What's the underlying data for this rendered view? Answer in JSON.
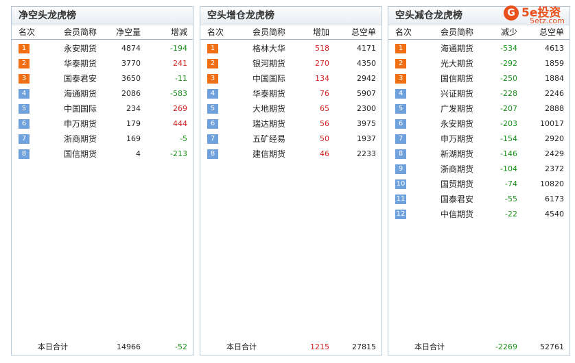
{
  "logo": {
    "mark": "G",
    "text": "5e投资",
    "sub": "5etz.com"
  },
  "panels": [
    {
      "title": "净空头龙虎榜",
      "headers": [
        "名次",
        "会员简称",
        "净空量",
        "增减"
      ],
      "rows": [
        {
          "rank": "1",
          "name": "永安期货",
          "v1": "4874",
          "v2": "-194",
          "c2": "green"
        },
        {
          "rank": "2",
          "name": "华泰期货",
          "v1": "3770",
          "v2": "241",
          "c2": "red"
        },
        {
          "rank": "3",
          "name": "国泰君安",
          "v1": "3650",
          "v2": "-11",
          "c2": "green"
        },
        {
          "rank": "4",
          "name": "海通期货",
          "v1": "2086",
          "v2": "-583",
          "c2": "green"
        },
        {
          "rank": "5",
          "name": "中国国际",
          "v1": "234",
          "v2": "269",
          "c2": "red"
        },
        {
          "rank": "6",
          "name": "申万期货",
          "v1": "179",
          "v2": "444",
          "c2": "red"
        },
        {
          "rank": "7",
          "name": "浙商期货",
          "v1": "169",
          "v2": "-5",
          "c2": "green"
        },
        {
          "rank": "8",
          "name": "国信期货",
          "v1": "4",
          "v2": "-213",
          "c2": "green"
        }
      ],
      "footer": {
        "label": "本日合计",
        "v1": "14966",
        "v2": "-52"
      }
    },
    {
      "title": "空头增仓龙虎榜",
      "headers": [
        "名次",
        "会员简称",
        "增加",
        "总空单"
      ],
      "rows": [
        {
          "rank": "1",
          "name": "格林大华",
          "v1": "518",
          "v2": "4171"
        },
        {
          "rank": "2",
          "name": "银河期货",
          "v1": "270",
          "v2": "4350"
        },
        {
          "rank": "3",
          "name": "中国国际",
          "v1": "134",
          "v2": "2942"
        },
        {
          "rank": "4",
          "name": "华泰期货",
          "v1": "76",
          "v2": "5907"
        },
        {
          "rank": "5",
          "name": "大地期货",
          "v1": "65",
          "v2": "2300"
        },
        {
          "rank": "6",
          "name": "瑞达期货",
          "v1": "56",
          "v2": "3975"
        },
        {
          "rank": "7",
          "name": "五矿经易",
          "v1": "50",
          "v2": "1937"
        },
        {
          "rank": "8",
          "name": "建信期货",
          "v1": "46",
          "v2": "2233"
        }
      ],
      "footer": {
        "label": "本日合计",
        "v1": "1215",
        "v2": "27815"
      }
    },
    {
      "title": "空头减仓龙虎榜",
      "headers": [
        "名次",
        "会员简称",
        "减少",
        "总空单"
      ],
      "rows": [
        {
          "rank": "1",
          "name": "海通期货",
          "v1": "-534",
          "v2": "4613"
        },
        {
          "rank": "2",
          "name": "光大期货",
          "v1": "-292",
          "v2": "1859"
        },
        {
          "rank": "3",
          "name": "国信期货",
          "v1": "-250",
          "v2": "1884"
        },
        {
          "rank": "4",
          "name": "兴证期货",
          "v1": "-228",
          "v2": "2246"
        },
        {
          "rank": "5",
          "name": "广发期货",
          "v1": "-207",
          "v2": "2888"
        },
        {
          "rank": "6",
          "name": "永安期货",
          "v1": "-203",
          "v2": "10017"
        },
        {
          "rank": "7",
          "name": "申万期货",
          "v1": "-154",
          "v2": "2920"
        },
        {
          "rank": "8",
          "name": "新湖期货",
          "v1": "-146",
          "v2": "2429"
        },
        {
          "rank": "9",
          "name": "浙商期货",
          "v1": "-104",
          "v2": "2372"
        },
        {
          "rank": "10",
          "name": "国贸期货",
          "v1": "-74",
          "v2": "10820"
        },
        {
          "rank": "11",
          "name": "国泰君安",
          "v1": "-55",
          "v2": "6173"
        },
        {
          "rank": "12",
          "name": "中信期货",
          "v1": "-22",
          "v2": "4540"
        }
      ],
      "footer": {
        "label": "本日合计",
        "v1": "-2269",
        "v2": "52761"
      }
    }
  ]
}
